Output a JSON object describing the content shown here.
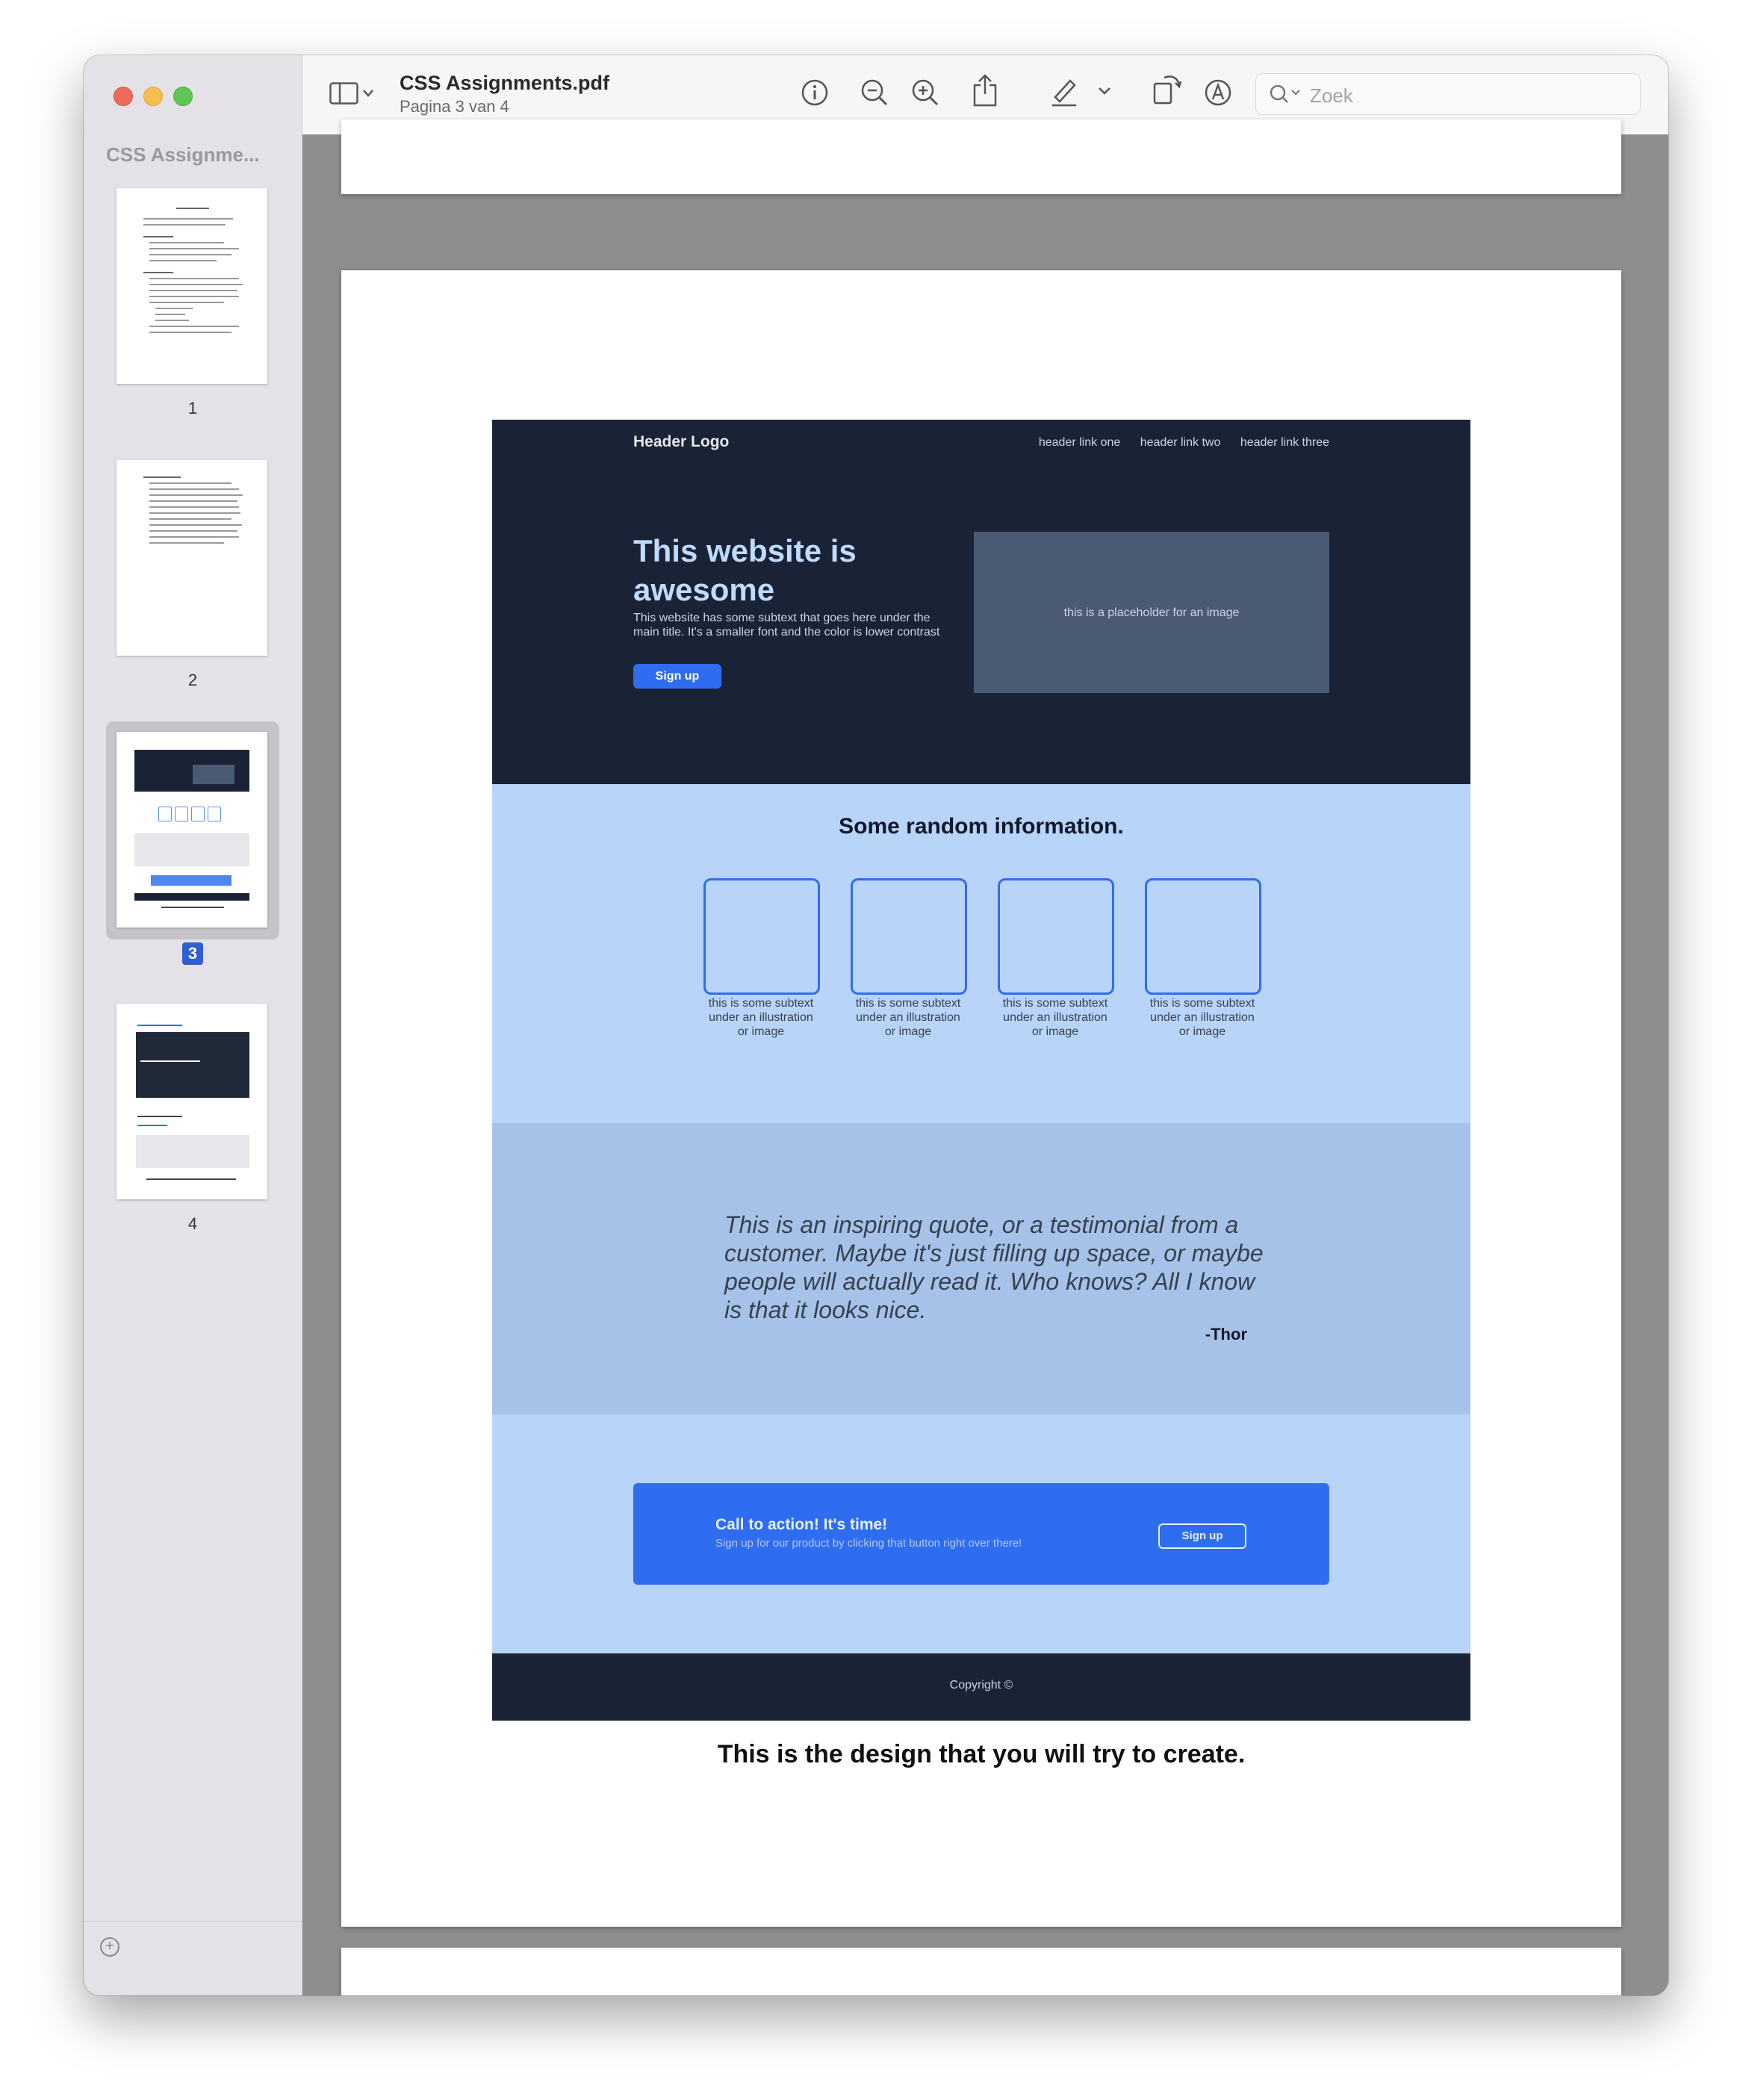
{
  "window": {
    "title": "CSS Assignments.pdf",
    "subtitle": "Pagina 3 van 4",
    "search_placeholder": "Zoek"
  },
  "sidebar": {
    "title": "CSS Assignme...",
    "pages": [
      {
        "label": "1",
        "selected": false
      },
      {
        "label": "2",
        "selected": false
      },
      {
        "label": "3",
        "selected": true
      },
      {
        "label": "4",
        "selected": false
      }
    ]
  },
  "design": {
    "header": {
      "logo": "Header Logo",
      "links": [
        "header link one",
        "header link two",
        "header link three"
      ]
    },
    "hero": {
      "title": "This website is awesome",
      "subtext": "This website has some subtext that goes here under the main title.  It's a smaller font and the color is lower contrast",
      "button": "Sign up",
      "image_placeholder": "this is a placeholder for an image"
    },
    "info": {
      "title": "Some random information.",
      "cards": [
        "this is some subtext under an illustration or image",
        "this is some subtext under an illustration or image",
        "this is some subtext under an illustration or image",
        "this is some subtext under an illustration or image"
      ]
    },
    "quote": {
      "text": "This is an inspiring quote, or a testimonial from a customer.  Maybe it's just filling up space, or maybe people will actually read it. Who knows?  All I know is that it looks nice.",
      "author": "-Thor"
    },
    "cta": {
      "title": "Call to action! It's time!",
      "subtext": "Sign up for our product by clicking that button right over there!",
      "button": "Sign up"
    },
    "footer": "Copyright ©"
  },
  "caption": "This is the design that you will try to create.",
  "colors": {
    "navy": "#1a2336",
    "light_blue": "#b8d4f8",
    "quote_blue": "#a6c2e8",
    "accent_blue": "#2f6df0"
  },
  "toolbar_icons": [
    "sidebar-toggle-icon",
    "info-icon",
    "zoom-out-icon",
    "zoom-in-icon",
    "share-icon",
    "highlight-pen-icon",
    "chevron-down-icon",
    "rotate-icon",
    "markup-icon",
    "search-icon"
  ]
}
